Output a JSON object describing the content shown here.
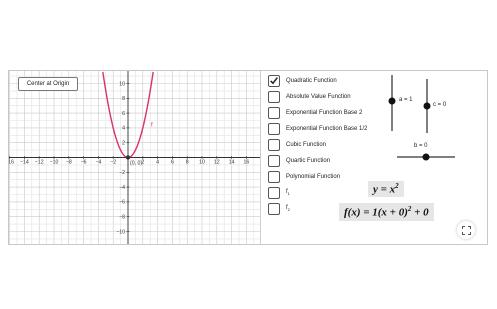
{
  "toolbar": {
    "center_label": "Center at Origin"
  },
  "graph": {
    "x_ticks": [
      "−16",
      "−14",
      "−12",
      "−10",
      "−8",
      "−6",
      "−4",
      "−2",
      "2",
      "4",
      "6",
      "8",
      "10",
      "12",
      "14",
      "16"
    ],
    "y_ticks": [
      "10",
      "8",
      "6",
      "4",
      "2",
      "−2",
      "−4",
      "−6",
      "−8",
      "−10",
      "−12"
    ],
    "origin_label": "(0, 0)",
    "curve_label": "f",
    "curve_color": "#d6336c",
    "x_range": [
      -17,
      17
    ],
    "y_range": [
      -13,
      11
    ],
    "function": "x^2"
  },
  "functions": [
    {
      "label": "Quadratic Function",
      "checked": true
    },
    {
      "label": "Absolute Value Function",
      "checked": false
    },
    {
      "label": "Exponential Function Base 2",
      "checked": false
    },
    {
      "label": "Exponential Function Base 1/2",
      "checked": false
    },
    {
      "label": "Cubic Function",
      "checked": false
    },
    {
      "label": "Quartic Function",
      "checked": false
    },
    {
      "label": "Polynomial Function",
      "checked": false
    },
    {
      "label": "f",
      "sub": "1",
      "checked": false
    },
    {
      "label": "f",
      "sub": "2",
      "checked": false
    }
  ],
  "sliders": {
    "a": {
      "label": "a = 1",
      "value": 1
    },
    "c": {
      "label": "c = 0",
      "value": 0
    },
    "b": {
      "label": "b = 0",
      "value": 0
    }
  },
  "formulas": {
    "simple_lhs": "y = x",
    "simple_exp": "2",
    "full_left": "f(x) = 1(x + 0)",
    "full_exp": "2",
    "full_right": " + 0"
  }
}
